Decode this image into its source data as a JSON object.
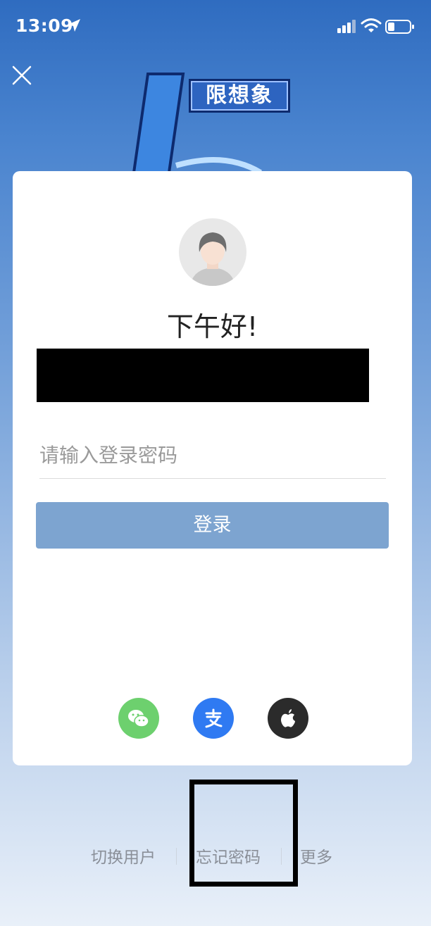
{
  "status_bar": {
    "time": "13:09",
    "icons": [
      "location-arrow-icon",
      "signal-icon",
      "wifi-icon",
      "battery-icon"
    ]
  },
  "header": {
    "close_icon": "close-icon",
    "banner_text": "限想象"
  },
  "card": {
    "greeting": "下午好!",
    "password_placeholder": "请输入登录密码",
    "login_label": "登录",
    "social_logins": [
      "wechat-icon",
      "alipay-icon",
      "apple-icon"
    ]
  },
  "bottom": {
    "switch_user": "切换用户",
    "forgot_password": "忘记密码",
    "more": "更多"
  },
  "colors": {
    "login_button": "#7da4d0",
    "wechat": "#6dd06e",
    "alipay": "#2f7af2",
    "apple": "#2b2b2b"
  }
}
